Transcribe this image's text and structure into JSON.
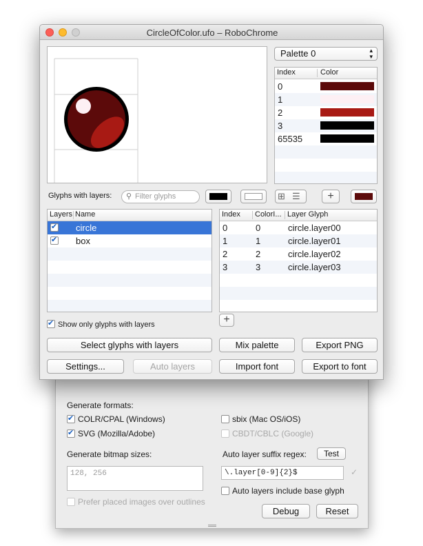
{
  "window": {
    "title": "CircleOfColor.ufo – RoboChrome"
  },
  "palette": {
    "selected": "Palette 0",
    "columns": [
      "Index",
      "Color"
    ],
    "rows": [
      {
        "index": "0",
        "color": "#5c0a0a"
      },
      {
        "index": "1",
        "color": "#fdf0f4"
      },
      {
        "index": "2",
        "color": "#a81a14"
      },
      {
        "index": "3",
        "color": "#000000"
      },
      {
        "index": "65535",
        "color": "#000000"
      }
    ]
  },
  "toolbar": {
    "glyphs_label": "Glyphs with layers:",
    "filter_placeholder": "Filter glyphs",
    "fg_color": "#000000",
    "bg_color": "#ffffff",
    "accent_color": "#5c0a0a"
  },
  "glyph_list": {
    "columns": [
      "Layers",
      "Name"
    ],
    "rows": [
      {
        "checked": true,
        "name": "circle",
        "selected": true
      },
      {
        "checked": true,
        "name": "box",
        "selected": false
      }
    ]
  },
  "layer_table": {
    "columns": [
      "Index",
      "ColorI...",
      "Layer Glyph"
    ],
    "rows": [
      {
        "index": "0",
        "color_index": "0",
        "glyph": "circle.layer00"
      },
      {
        "index": "1",
        "color_index": "1",
        "glyph": "circle.layer01"
      },
      {
        "index": "2",
        "color_index": "2",
        "glyph": "circle.layer02"
      },
      {
        "index": "3",
        "color_index": "3",
        "glyph": "circle.layer03"
      }
    ]
  },
  "show_only_label": "Show only glyphs with layers",
  "buttons": {
    "select_glyphs": "Select glyphs with layers",
    "mix_palette": "Mix palette",
    "export_png": "Export PNG",
    "settings": "Settings...",
    "auto_layers": "Auto layers",
    "import_font": "Import font",
    "export_to_font": "Export to font"
  },
  "settings": {
    "generate_formats_label": "Generate formats:",
    "formats": [
      {
        "label": "COLR/CPAL (Windows)",
        "checked": true,
        "enabled": true
      },
      {
        "label": "SVG (Mozilla/Adobe)",
        "checked": true,
        "enabled": true
      },
      {
        "label": "sbix (Mac OS/iOS)",
        "checked": false,
        "enabled": true
      },
      {
        "label": "CBDT/CBLC (Google)",
        "checked": false,
        "enabled": false
      }
    ],
    "bitmap_label": "Generate bitmap sizes:",
    "bitmap_placeholder": "128, 256",
    "prefer_placed_label": "Prefer placed images over outlines",
    "suffix_label": "Auto layer suffix regex:",
    "test_button": "Test",
    "regex_value": "\\.layer[0-9]{2}$",
    "include_base_label": "Auto layers include base glyph",
    "debug_button": "Debug",
    "reset_button": "Reset"
  }
}
